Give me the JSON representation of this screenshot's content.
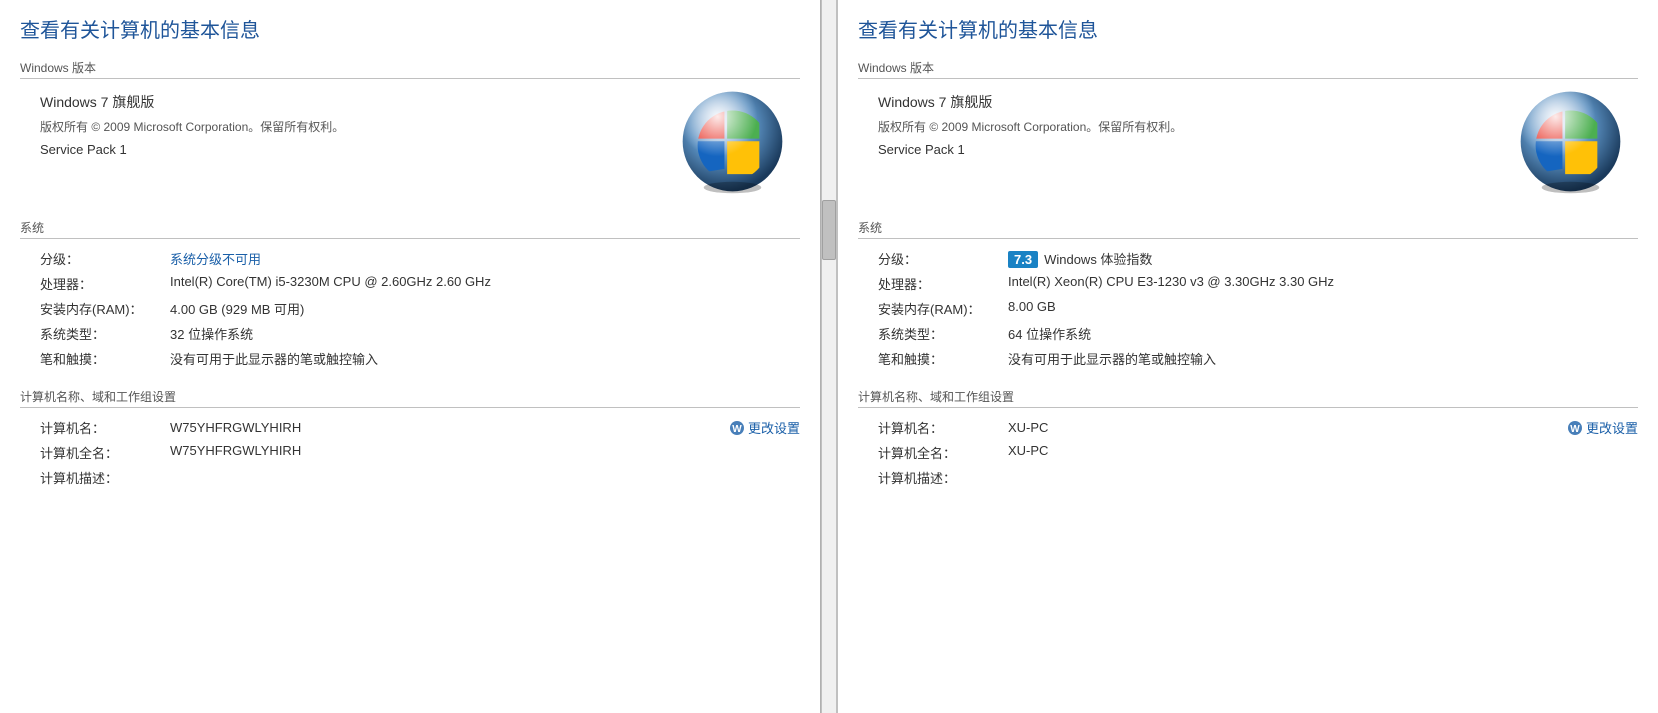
{
  "left_panel": {
    "title": "查看有关计算机的基本信息",
    "windows_version_label": "Windows 版本",
    "edition": "Windows 7 旗舰版",
    "copyright": "版权所有 © 2009 Microsoft Corporation。保留所有权利。",
    "service_pack": "Service Pack 1",
    "system_label": "系统",
    "rating_label": "分级：",
    "rating_value": "系统分级不可用",
    "processor_label": "处理器：",
    "processor_value": "Intel(R) Core(TM) i5-3230M CPU @ 2.60GHz   2.60 GHz",
    "ram_label": "安装内存(RAM)：",
    "ram_value": "4.00 GB (929 MB 可用)",
    "system_type_label": "系统类型：",
    "system_type_value": "32 位操作系统",
    "pen_label": "笔和触摸：",
    "pen_value": "没有可用于此显示器的笔或触控输入",
    "computer_section_label": "计算机名称、域和工作组设置",
    "computer_name_label": "计算机名：",
    "computer_name_value": "W75YHFRGWLYHIRH",
    "change_settings": "更改设置",
    "full_name_label": "计算机全名：",
    "full_name_value": "W75YHFRGWLYHIRH",
    "description_label": "计算机描述："
  },
  "right_panel": {
    "title": "查看有关计算机的基本信息",
    "windows_version_label": "Windows 版本",
    "edition": "Windows 7 旗舰版",
    "copyright": "版权所有 © 2009 Microsoft Corporation。保留所有权利。",
    "service_pack": "Service Pack 1",
    "system_label": "系统",
    "rating_label": "分级：",
    "rating_score": "7.3",
    "rating_text": "Windows 体验指数",
    "processor_label": "处理器：",
    "processor_value": "Intel(R) Xeon(R) CPU E3-1230 v3 @ 3.30GHz   3.30 GHz",
    "ram_label": "安装内存(RAM)：",
    "ram_value": "8.00 GB",
    "system_type_label": "系统类型：",
    "system_type_value": "64 位操作系统",
    "pen_label": "笔和触摸：",
    "pen_value": "没有可用于此显示器的笔或触控输入",
    "computer_section_label": "计算机名称、域和工作组设置",
    "computer_name_label": "计算机名：",
    "computer_name_value": "XU-PC",
    "change_settings": "更改设置",
    "full_name_label": "计算机全名：",
    "full_name_value": "XU-PC",
    "description_label": "计算机描述："
  }
}
